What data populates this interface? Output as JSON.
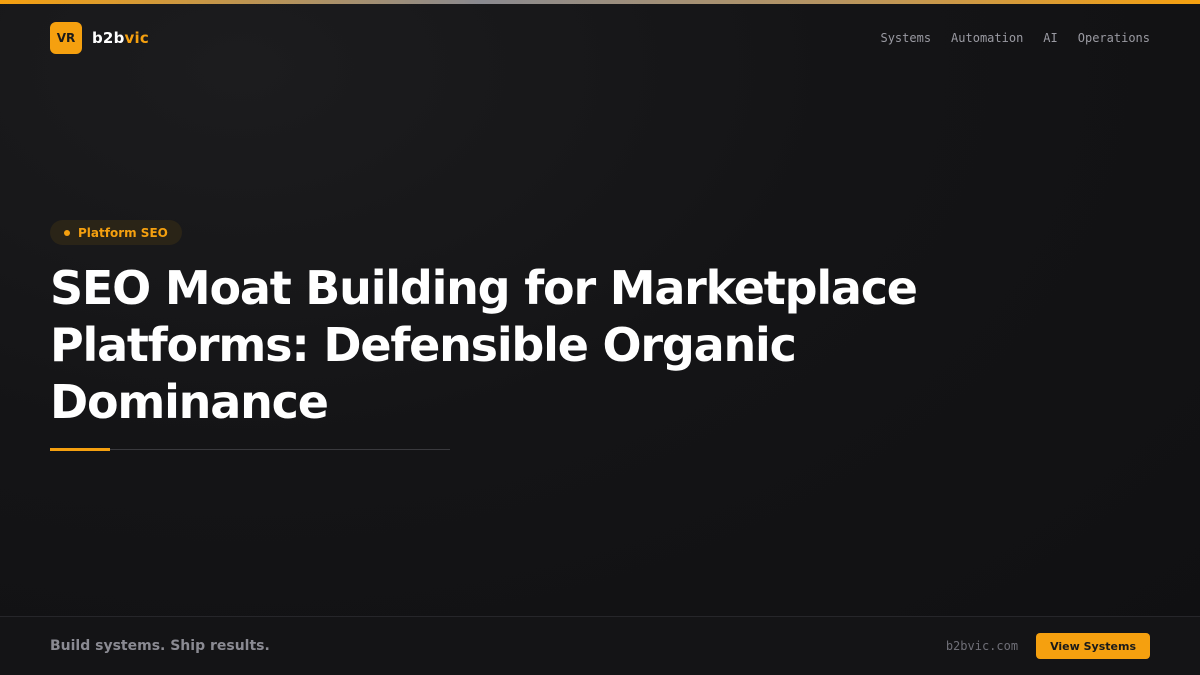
{
  "header": {
    "logo_text": "VR",
    "brand_part1": "b2b",
    "brand_part2": "vic",
    "nav": [
      {
        "label": "Systems"
      },
      {
        "label": "Automation"
      },
      {
        "label": "AI"
      },
      {
        "label": "Operations"
      }
    ]
  },
  "hero": {
    "badge": "Platform SEO",
    "title": "SEO Moat Building for Marketplace Platforms: Defensible Organic Dominance"
  },
  "footer": {
    "tagline": "Build systems. Ship results.",
    "domain": "b2bvic.com",
    "cta_label": "View Systems"
  },
  "colors": {
    "accent": "#f5a00f",
    "background": "#111113",
    "muted_text": "#9a9aa2"
  }
}
